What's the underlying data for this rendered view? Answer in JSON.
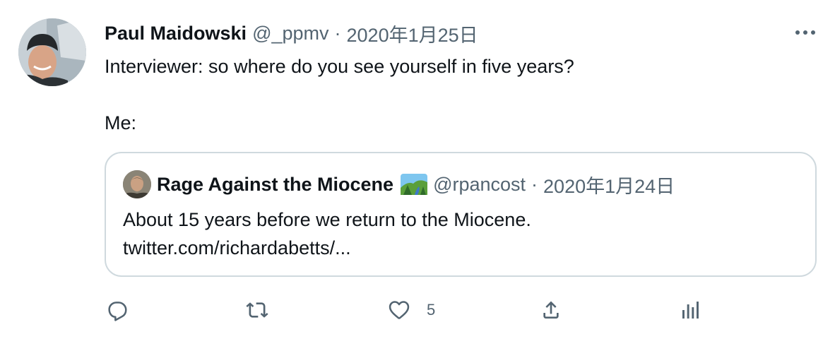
{
  "tweet": {
    "author_name": "Paul Maidowski",
    "author_handle": "@_ppmv",
    "separator": "·",
    "date": "2020年1月25日",
    "text": "Interviewer: so where do you see yourself in five years?\n\nMe:"
  },
  "quoted_tweet": {
    "author_name": "Rage Against the Miocene",
    "emoji_icon": "national-park-emoji",
    "author_handle": "@rpancost",
    "separator": "·",
    "date": "2020年1月24日",
    "text_line1": "About 15 years before we return to the Miocene.",
    "text_line2": "twitter.com/richardabetts/..."
  },
  "actions": {
    "reply": {
      "icon": "reply-icon"
    },
    "retweet": {
      "icon": "retweet-icon"
    },
    "like": {
      "icon": "heart-icon",
      "count": "5"
    },
    "share": {
      "icon": "share-icon"
    },
    "analytics": {
      "icon": "analytics-icon"
    }
  },
  "colors": {
    "text_primary": "#0f1419",
    "text_secondary": "#536471",
    "border": "#cfd9de"
  }
}
